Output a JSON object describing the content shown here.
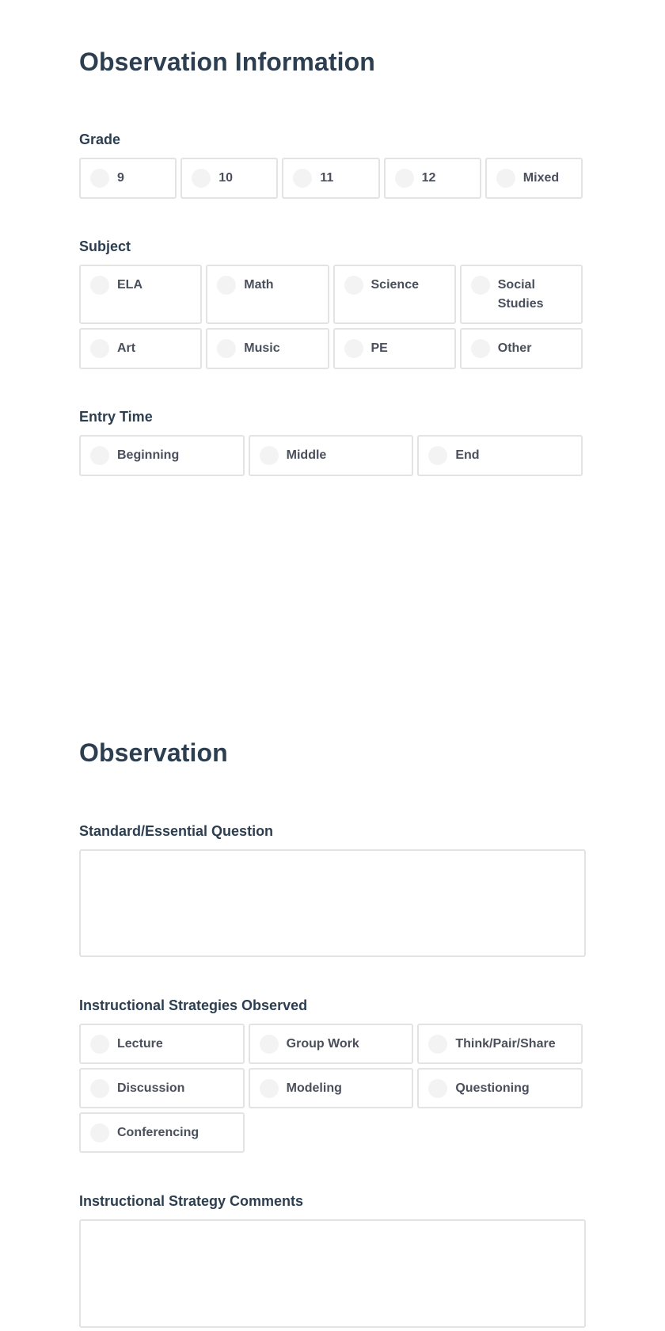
{
  "sections": {
    "observation_information": {
      "title": "Observation Information",
      "grade": {
        "label": "Grade",
        "options": [
          "9",
          "10",
          "11",
          "12",
          "Mixed"
        ]
      },
      "subject": {
        "label": "Subject",
        "options": [
          "ELA",
          "Math",
          "Science",
          "Social Studies",
          "Art",
          "Music",
          "PE",
          "Other"
        ]
      },
      "entry_time": {
        "label": "Entry Time",
        "options": [
          "Beginning",
          "Middle",
          "End"
        ]
      }
    },
    "observation": {
      "title": "Observation",
      "standard_question": {
        "label": "Standard/Essential Question",
        "value": ""
      },
      "strategies": {
        "label": "Instructional Strategies Observed",
        "options": [
          "Lecture",
          "Group Work",
          "Think/Pair/Share",
          "Discussion",
          "Modeling",
          "Questioning",
          "Conferencing"
        ]
      },
      "strategy_comments": {
        "label": "Instructional Strategy Comments",
        "value": ""
      }
    }
  },
  "colors": {
    "heading": "#2c3e50",
    "option_text": "#4a4f5c",
    "card_border": "#e3e3e3",
    "radio_fill": "#f3f3f3"
  }
}
